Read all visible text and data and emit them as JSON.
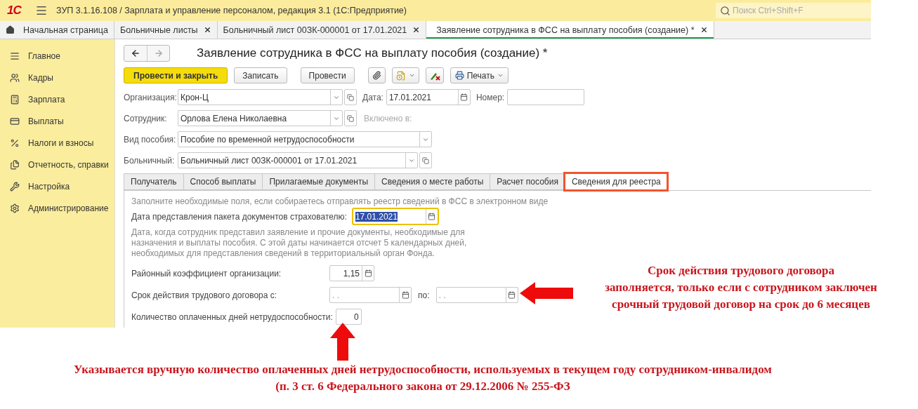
{
  "app": {
    "logo": "1С",
    "title": "ЗУП 3.1.16.108 / Зарплата и управление персоналом, редакция 3.1  (1С:Предприятие)",
    "search_placeholder": "Поиск Ctrl+Shift+F"
  },
  "open_tabs": [
    {
      "label": "Начальная страница",
      "kind": "home",
      "closable": false,
      "selected": false
    },
    {
      "label": "Больничные листы",
      "kind": "page",
      "closable": true,
      "selected": false
    },
    {
      "label": "Больничный лист 00ЗК-000001 от 17.01.2021",
      "kind": "page",
      "closable": true,
      "selected": false
    },
    {
      "label": "Заявление сотрудника в ФСС на выплату пособия (создание) *",
      "kind": "page",
      "closable": true,
      "selected": true
    }
  ],
  "sidebar": {
    "items": [
      {
        "label": "Главное"
      },
      {
        "label": "Кадры"
      },
      {
        "label": "Зарплата"
      },
      {
        "label": "Выплаты"
      },
      {
        "label": "Налоги и взносы"
      },
      {
        "label": "Отчетность, справки"
      },
      {
        "label": "Настройка"
      },
      {
        "label": "Администрирование"
      }
    ]
  },
  "form": {
    "title": "Заявление сотрудника в ФСС на выплату пособия (создание) *",
    "nav": {
      "back_enabled": true,
      "forward_enabled": false
    },
    "toolbar": [
      {
        "kind": "primary",
        "label": "Провести и закрыть"
      },
      {
        "kind": "plain",
        "label": "Записать"
      },
      {
        "kind": "plain",
        "label": "Провести"
      },
      {
        "kind": "paperclip"
      },
      {
        "kind": "file-menu"
      },
      {
        "kind": "pencil"
      },
      {
        "kind": "printer-menu",
        "label": "Печать"
      }
    ],
    "rows": [
      [
        {
          "kind": "field",
          "label": "Организация:",
          "value": "Крон-Ц",
          "dropdown": true,
          "open": true,
          "calendar": false
        },
        {
          "kind": "field",
          "label": "Дата:",
          "value": "17.01.2021",
          "dropdown": false,
          "open": false,
          "calendar": true
        },
        {
          "kind": "field",
          "label": "Номер:",
          "dropdown": false,
          "open": false,
          "calendar": false
        }
      ],
      [
        {
          "kind": "field",
          "label": "Сотрудник:",
          "value": "Орлова Елена Николаевна",
          "dropdown": true,
          "open": true,
          "calendar": false
        },
        {
          "kind": "note",
          "label": "Включено в:",
          "disabled": true
        }
      ],
      [
        {
          "kind": "field",
          "label": "Вид пособия:",
          "value": "Пособие по временной нетрудоспособности",
          "dropdown": true,
          "open": false,
          "calendar": false
        }
      ],
      [
        {
          "kind": "field",
          "label": "Больничный:",
          "value": "Больничный лист 00ЗК-000001 от 17.01.2021",
          "dropdown": true,
          "open": true,
          "calendar": false
        }
      ]
    ],
    "tabs": [
      {
        "label": "Получатель",
        "selected": false,
        "outlined": false
      },
      {
        "label": "Способ выплаты",
        "selected": false,
        "outlined": false
      },
      {
        "label": "Прилагаемые документы",
        "selected": false,
        "outlined": false
      },
      {
        "label": "Сведения о месте работы",
        "selected": false,
        "outlined": false
      },
      {
        "label": "Расчет пособия",
        "selected": false,
        "outlined": false
      },
      {
        "label": "Сведения для реестра",
        "selected": true,
        "outlined": true
      }
    ],
    "register": {
      "hint": "Заполните необходимые поля, если собираетесь отправлять реестр сведений в ФСС в электронном виде",
      "date_label": "Дата представления пакета документов страхователю:",
      "date_value": "17.01.2021",
      "date_focused": true,
      "description": [
        "Дата, когда сотрудник представил заявление и прочие документы, необходимые для",
        "назначения и выплаты пособия. С этой даты начинается отсчет 5 календарных дней,",
        "необходимых для представления сведений в территориальный орган Фонда."
      ],
      "coefficient_label": "Районный коэффициент организации:",
      "coefficient_value": "1,15",
      "contract_label": "Срок действия трудового договора с:",
      "contract_from": ".  .",
      "to_label": "по:",
      "contract_to": ".  .",
      "paid_days_label": "Количество оплаченных дней нетрудоспособности:",
      "paid_days_value": "0"
    }
  },
  "annotations": [
    {
      "kind": "arrow-left",
      "lines": [
        "Срок действия трудового договора",
        "заполняется, только если с сотрудником заключен",
        "срочный трудовой договор на срок до 6 месяцев"
      ]
    },
    {
      "kind": "arrow-up",
      "lines": [
        "Указывается вручную количество оплаченных дней нетрудоспособности, используемых в текущем году сотрудником-инвалидом",
        "(п. 3 ст. 6 Федерального закона от 29.12.2006 № 255-ФЗ"
      ]
    }
  ]
}
